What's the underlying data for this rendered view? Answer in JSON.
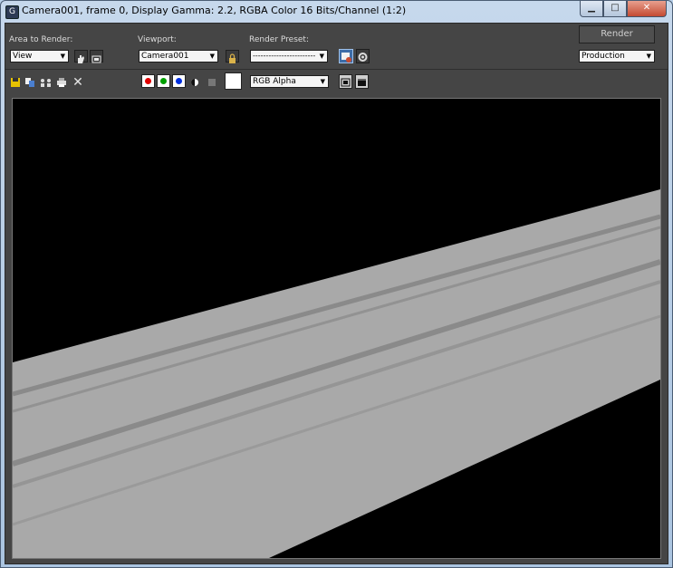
{
  "window": {
    "title": "Camera001, frame 0, Display Gamma: 2.2, RGBA Color 16 Bits/Channel (1:2)",
    "icon": "3dsmax-icon"
  },
  "caption": {
    "minimize": "minimize-icon",
    "maximize": "maximize-icon",
    "close": "close-icon"
  },
  "header": {
    "area_to_render_label": "Area to Render:",
    "area_to_render_value": "View",
    "viewport_label": "Viewport:",
    "viewport_value": "Camera001",
    "render_preset_label": "Render Preset:",
    "render_preset_value": "------------------------",
    "render_button": "Render",
    "render_mode_value": "Production"
  },
  "toolbar": {
    "channel_display_value": "RGB Alpha",
    "channel_colors": {
      "red": "#e00000",
      "green": "#00a000",
      "blue": "#0030e0"
    }
  },
  "render": {
    "background": "#000000",
    "surface_color": "#a9a9a9"
  }
}
